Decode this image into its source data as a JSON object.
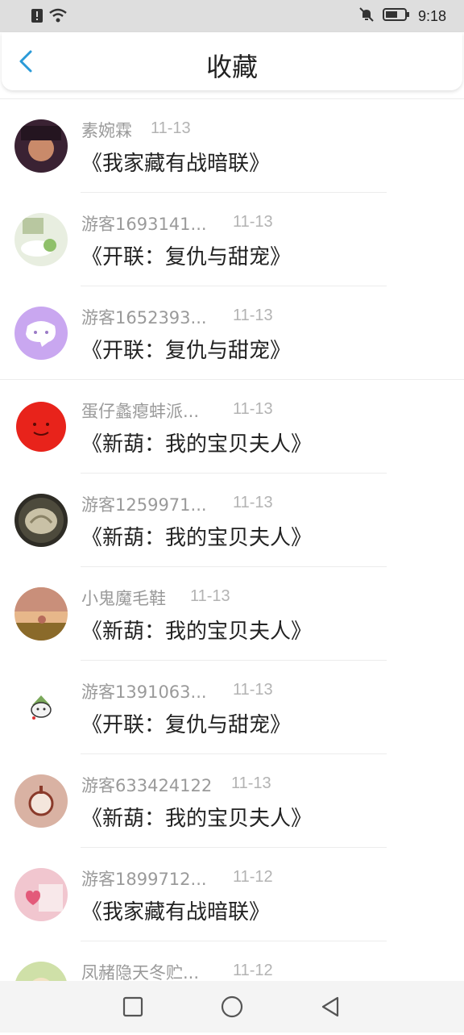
{
  "status_bar": {
    "time": "9:18"
  },
  "header": {
    "title": "收藏"
  },
  "items": [
    {
      "name": "素婉霖",
      "time": "11-13",
      "book": "《我家藏有战暗联》",
      "avatar_colors": [
        "#3a2233",
        "#c98a6a"
      ]
    },
    {
      "name": "游客1693141...",
      "time": "11-13",
      "book": "《开联：复仇与甜宠》",
      "avatar_colors": [
        "#e8eee0",
        "#8fc06a"
      ]
    },
    {
      "name": "游客1652393...",
      "time": "11-13",
      "book": "《开联：复仇与甜宠》",
      "avatar_colors": [
        "#c9a7f0",
        "#ffffff"
      ]
    },
    {
      "name": "蛋仔蠡瘪蚌派...",
      "time": "11-13",
      "book": "《新葫：我的宝贝夫人》",
      "avatar_colors": [
        "#e8231b",
        "#b0120d"
      ]
    },
    {
      "name": "游客1259971...",
      "time": "11-13",
      "book": "《新葫：我的宝贝夫人》",
      "avatar_colors": [
        "#4d4a3c",
        "#c9c1a6"
      ]
    },
    {
      "name": "小鬼魔毛鞋",
      "time": "11-13",
      "book": "《新葫：我的宝贝夫人》",
      "avatar_colors": [
        "#e7b78a",
        "#b76b5b"
      ]
    },
    {
      "name": "游客1391063...",
      "time": "11-13",
      "book": "《开联：复仇与甜宠》",
      "avatar_colors": [
        "#ffffff",
        "#7aa85a"
      ]
    },
    {
      "name": "游客633424122",
      "time": "11-13",
      "book": "《新葫：我的宝贝夫人》",
      "avatar_colors": [
        "#d9b2a3",
        "#8a3a2a"
      ]
    },
    {
      "name": "游客1899712...",
      "time": "11-12",
      "book": "《我家藏有战暗联》",
      "avatar_colors": [
        "#f1c6cf",
        "#e35a7a"
      ]
    },
    {
      "name": "凤赭隐天冬贮...",
      "time": "11-12",
      "book": "",
      "avatar_colors": [
        "#cfe0a8",
        "#f3e3c3"
      ]
    }
  ]
}
